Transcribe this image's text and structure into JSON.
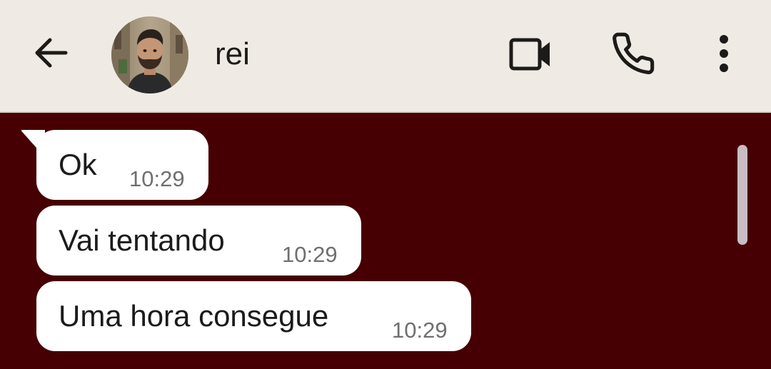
{
  "colors": {
    "header_bg": "#efebe4",
    "chat_bg": "#460003",
    "bubble_bg": "#ffffff",
    "icon_color": "#1d1b19"
  },
  "header": {
    "contact_name": "rei",
    "icons": {
      "back": "back-arrow-icon",
      "video": "video-camera-icon",
      "call": "phone-icon",
      "menu": "more-vertical-icon"
    }
  },
  "messages": [
    {
      "text": "Ok",
      "time": "10:29"
    },
    {
      "text": "Vai tentando",
      "time": "10:29"
    },
    {
      "text": "Uma hora consegue",
      "time": "10:29"
    }
  ]
}
